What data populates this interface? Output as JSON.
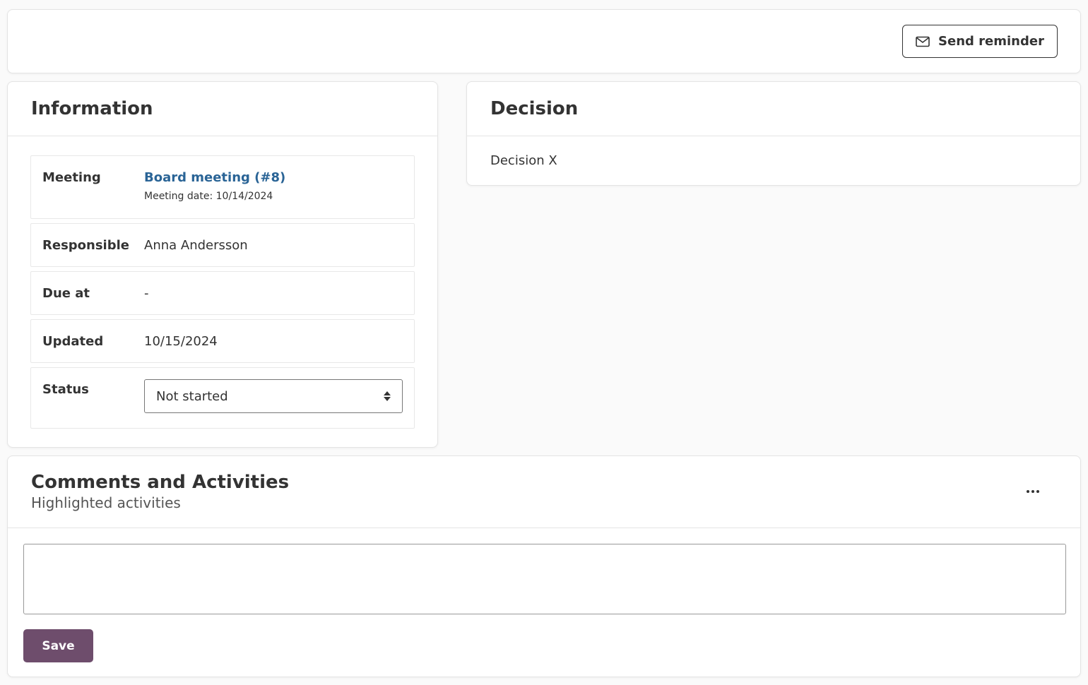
{
  "toolbar": {
    "send_reminder_label": "Send reminder"
  },
  "information": {
    "title": "Information",
    "meeting_label": "Meeting",
    "meeting_link": "Board meeting (#8)",
    "meeting_date": "Meeting date: 10/14/2024",
    "responsible_label": "Responsible",
    "responsible_value": "Anna Andersson",
    "due_label": "Due at",
    "due_value": "-",
    "updated_label": "Updated",
    "updated_value": "10/15/2024",
    "status_label": "Status",
    "status_value": "Not started"
  },
  "decision": {
    "title": "Decision",
    "text": "Decision X"
  },
  "comments": {
    "title": "Comments and Activities",
    "subtitle": "Highlighted activities",
    "comment_value": "",
    "save_label": "Save"
  },
  "colors": {
    "link": "#2a6496",
    "save_button": "#6e4d6c"
  },
  "icons": {
    "send_reminder": "envelope-icon",
    "status_select": "sort-arrows-icon",
    "more": "ellipsis-icon"
  }
}
